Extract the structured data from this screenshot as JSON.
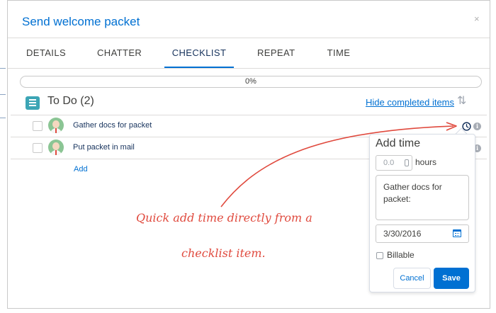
{
  "modal": {
    "title": "Send welcome packet",
    "close_glyph": "×"
  },
  "tabs": [
    {
      "label": "DETAILS",
      "active": false
    },
    {
      "label": "CHATTER",
      "active": false
    },
    {
      "label": "CHECKLIST",
      "active": true
    },
    {
      "label": "REPEAT",
      "active": false
    },
    {
      "label": "TIME",
      "active": false
    }
  ],
  "progress": {
    "label": "0%",
    "value": 0
  },
  "todo": {
    "title": "To Do (2)",
    "icon": "checklist-icon",
    "hide_link": "Hide completed items",
    "sort_glyph": "⇅",
    "items": [
      {
        "label": "Gather docs for packet"
      },
      {
        "label": "Put packet in mail"
      }
    ],
    "add_label": "Add"
  },
  "add_time": {
    "title": "Add time",
    "hours_value": "0.0",
    "hours_label": "hours",
    "description": "Gather docs for packet:",
    "date": "3/30/2016",
    "billable_label": "Billable",
    "cancel_label": "Cancel",
    "save_label": "Save"
  },
  "annotation": {
    "line1": "Quick add time directly from a",
    "line2": "checklist item."
  },
  "colors": {
    "brand": "#0070d2",
    "annotation": "#e04a3e",
    "todo_icon": "#3ca5b5"
  }
}
